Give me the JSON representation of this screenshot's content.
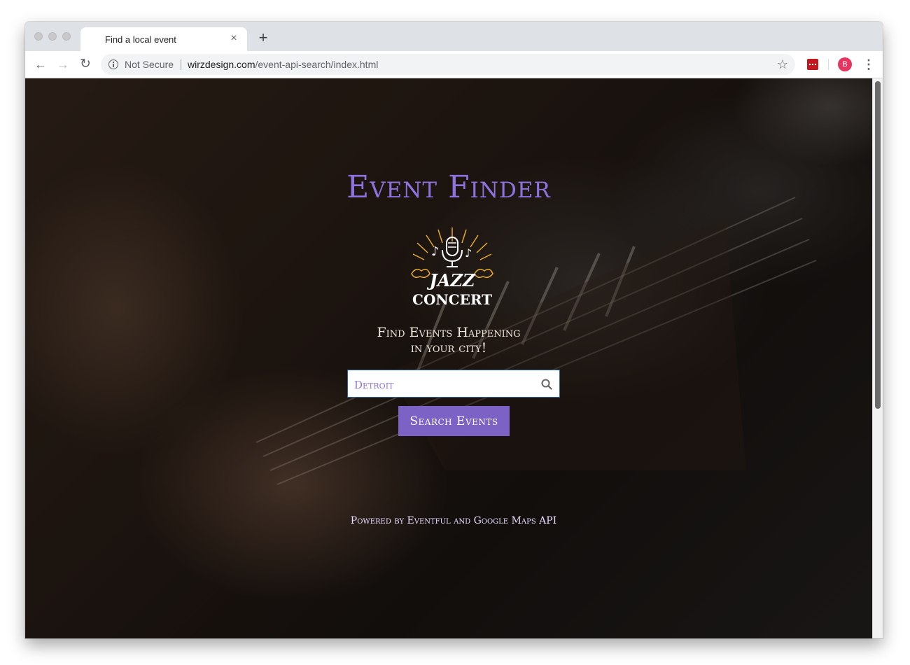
{
  "browser": {
    "tab_title": "Find a local event",
    "tab_close": "×",
    "new_tab": "+",
    "security_label": "Not Secure",
    "url_host": "wirzdesign.com",
    "url_path": "/event-api-search/index.html",
    "avatar_initial": "B",
    "menu_glyph": "⋮",
    "star_glyph": "☆",
    "back_glyph": "←",
    "forward_glyph": "→",
    "reload_glyph": "↻"
  },
  "page": {
    "title": "Event Finder",
    "logo": {
      "line1": "JAZZ",
      "line2": "CONCERT"
    },
    "subtitle_line1": "Find Events Happening",
    "subtitle_line2": "in your city!",
    "search": {
      "value": "Detroit"
    },
    "search_button": "Search Events",
    "footer": "Powered by Eventful and Google Maps API"
  },
  "colors": {
    "accent": "#8e72e0",
    "button": "#7c62c4",
    "avatar": "#e8335e",
    "extension": "#c5161d"
  }
}
